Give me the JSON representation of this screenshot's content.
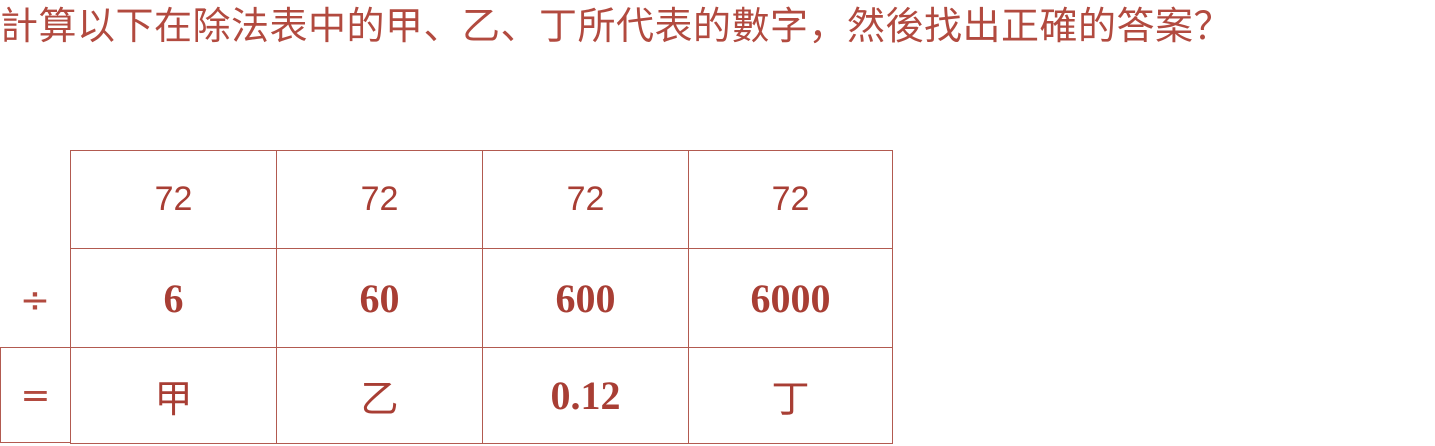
{
  "question": {
    "text": "計算以下在除法表中的甲、乙、丁所代表的數字，然後找出正確的答案？"
  },
  "table": {
    "divide_symbol": "÷",
    "equals_symbol": "=",
    "columns": [
      {
        "dividend": "72",
        "divisor": "6",
        "result": "甲"
      },
      {
        "dividend": "72",
        "divisor": "60",
        "result": "乙"
      },
      {
        "dividend": "72",
        "divisor": "600",
        "result": "0.12"
      },
      {
        "dividend": "72",
        "divisor": "6000",
        "result": "丁"
      }
    ]
  },
  "colors": {
    "text": "#b24a3f",
    "border": "#b25a50"
  }
}
